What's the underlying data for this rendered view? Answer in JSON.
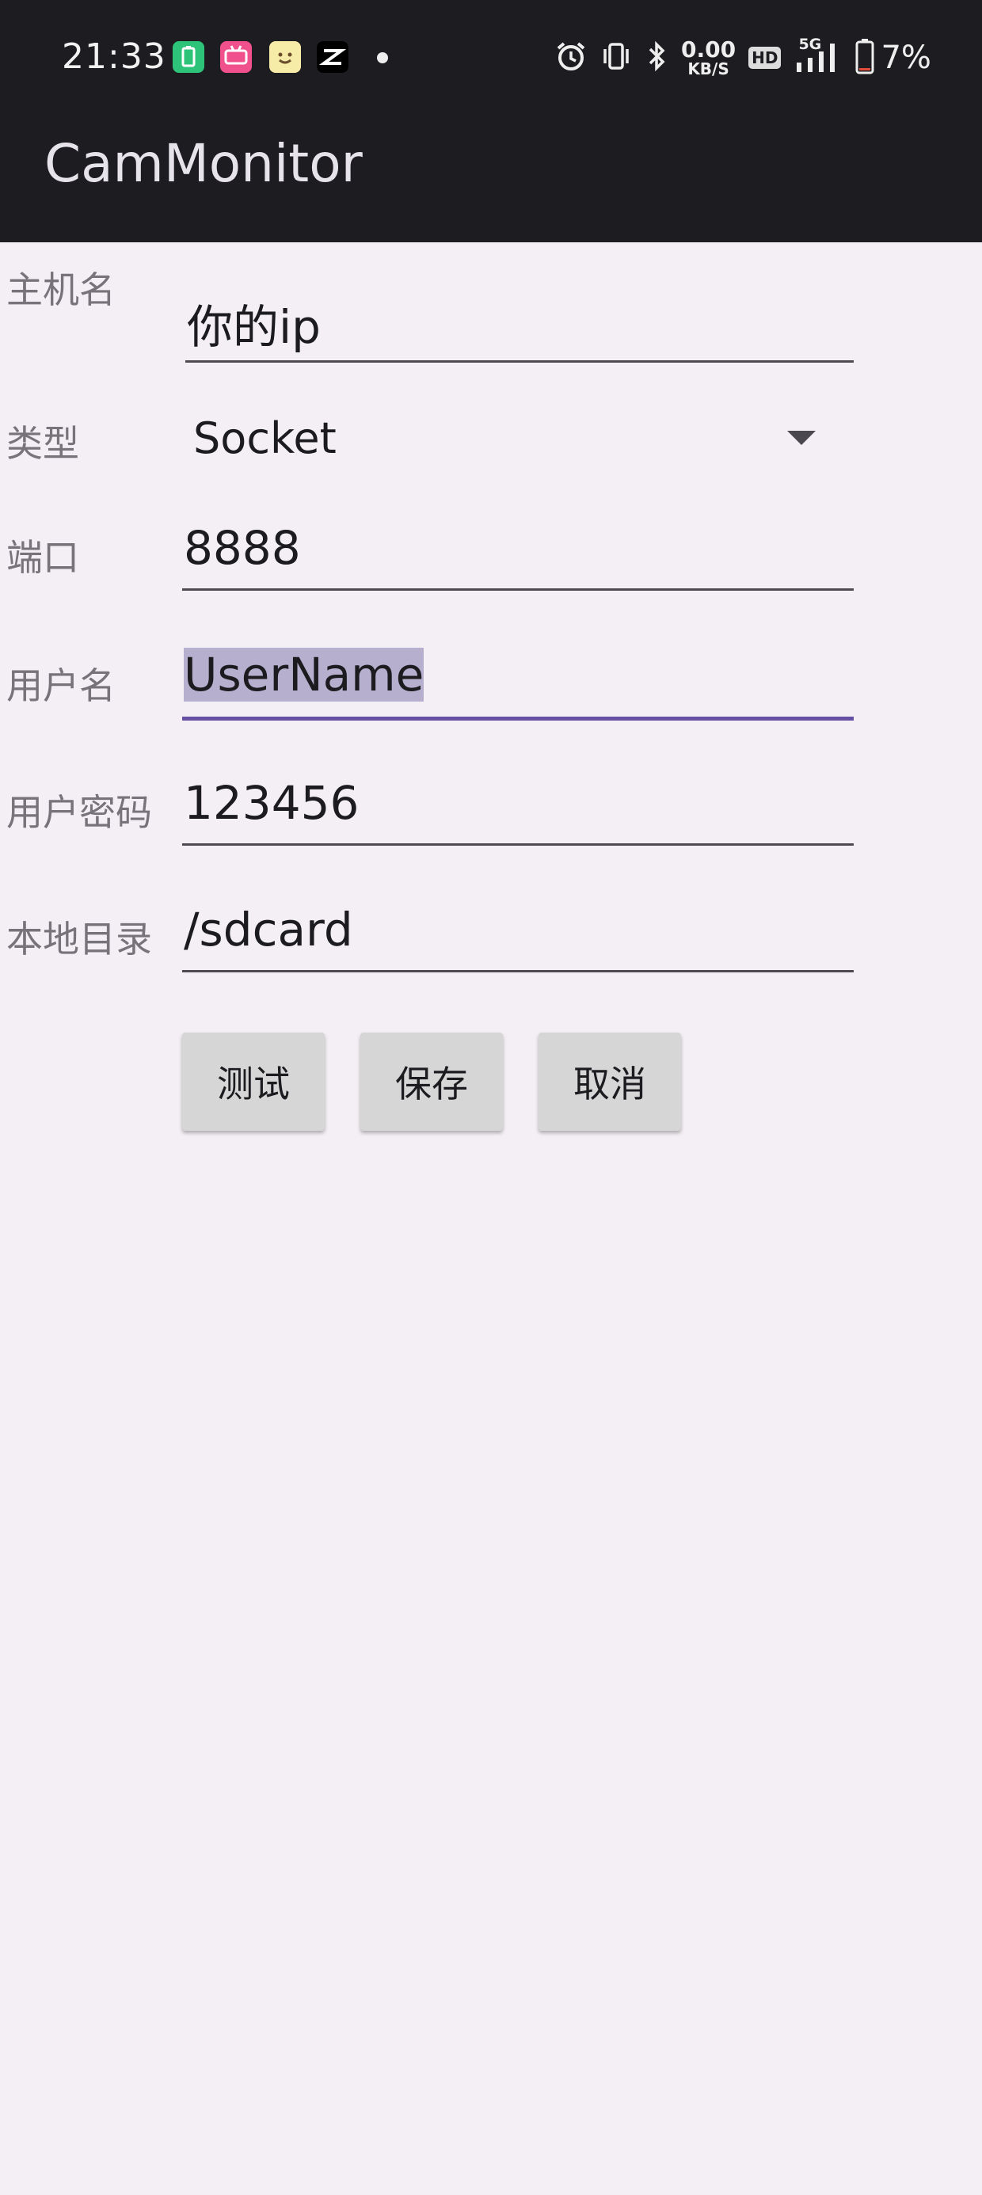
{
  "status_bar": {
    "time": "21:33",
    "net_speed_value": "0.00",
    "net_speed_unit": "KB/S",
    "hd_label": "HD",
    "network_label": "5G",
    "battery_percent": "7%",
    "notification_icons": [
      "phone-manager-icon",
      "bilibili-icon",
      "emoji-app-icon",
      "capcut-icon",
      "dot-icon"
    ],
    "system_icons": [
      "alarm-icon",
      "vibrate-icon",
      "bluetooth-icon",
      "signal-icon",
      "battery-icon"
    ]
  },
  "app_bar": {
    "title": "CamMonitor"
  },
  "form": {
    "host": {
      "label": "主机名",
      "value": "你的ip"
    },
    "type": {
      "label": "类型",
      "value": "Socket"
    },
    "port": {
      "label": "端口",
      "value": "8888"
    },
    "username": {
      "label": "用户名",
      "value": "UserName"
    },
    "password": {
      "label": "用户密码",
      "value": "123456"
    },
    "local_dir": {
      "label": "本地目录",
      "value": "/sdcard"
    }
  },
  "buttons": {
    "test": "测试",
    "save": "保存",
    "cancel": "取消"
  },
  "colors": {
    "topbar_bg": "#1D1C21",
    "page_bg": "#F3EFF4",
    "accent": "#6650A4",
    "selection": "#B6B0CE",
    "button_bg": "#D6D6D6"
  }
}
